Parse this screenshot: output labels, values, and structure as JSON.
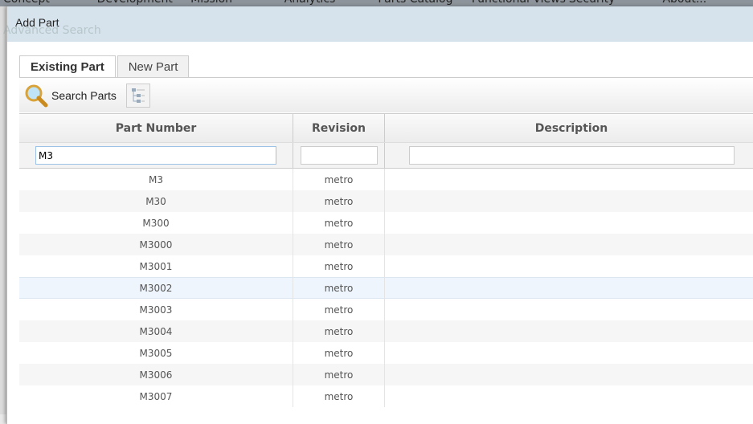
{
  "background": {
    "nav": [
      "Concept",
      "Development",
      "Mission",
      "Analytics",
      "Parts Catalog",
      "Functional Views",
      "Security",
      "About..."
    ],
    "advanced_search": "Advanced Search"
  },
  "dialog": {
    "title": "Add Part"
  },
  "tabs": [
    {
      "label": "Existing Part",
      "active": true
    },
    {
      "label": "New Part",
      "active": false
    }
  ],
  "toolbar": {
    "search_label": "Search Parts"
  },
  "grid": {
    "columns": [
      "Part Number",
      "Revision",
      "Description"
    ],
    "filters": {
      "part_number": "M3",
      "revision": "",
      "description": ""
    },
    "rows": [
      {
        "part": "M3",
        "rev": "metro",
        "desc": ""
      },
      {
        "part": "M30",
        "rev": "metro",
        "desc": ""
      },
      {
        "part": "M300",
        "rev": "metro",
        "desc": ""
      },
      {
        "part": "M3000",
        "rev": "metro",
        "desc": ""
      },
      {
        "part": "M3001",
        "rev": "metro",
        "desc": ""
      },
      {
        "part": "M3002",
        "rev": "metro",
        "desc": ""
      },
      {
        "part": "M3003",
        "rev": "metro",
        "desc": ""
      },
      {
        "part": "M3004",
        "rev": "metro",
        "desc": ""
      },
      {
        "part": "M3005",
        "rev": "metro",
        "desc": ""
      },
      {
        "part": "M3006",
        "rev": "metro",
        "desc": ""
      },
      {
        "part": "M3007",
        "rev": "metro",
        "desc": ""
      }
    ],
    "selected_index": 5
  }
}
